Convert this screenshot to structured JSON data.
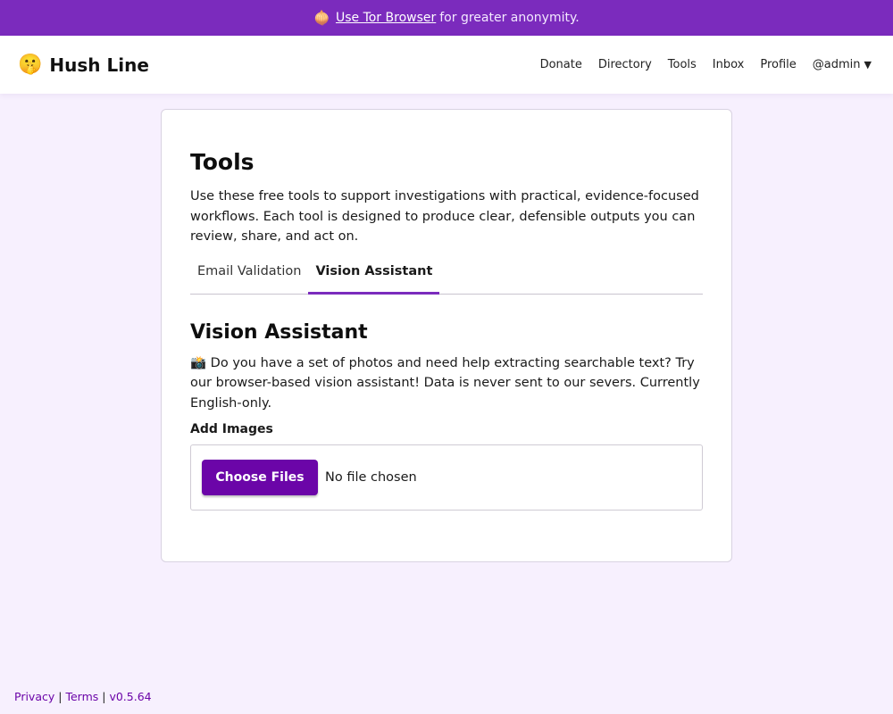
{
  "banner": {
    "icon": "onion-icon",
    "link_text": "Use Tor Browser",
    "suffix": "for greater anonymity."
  },
  "header": {
    "logo_emoji": "🤫",
    "brand": "Hush Line",
    "nav": {
      "donate": "Donate",
      "directory": "Directory",
      "tools": "Tools",
      "inbox": "Inbox",
      "profile": "Profile",
      "user": "@admin",
      "user_caret": "▼"
    }
  },
  "main": {
    "title": "Tools",
    "intro": "Use these free tools to support investigations with practical, evidence-focused workflows. Each tool is designed to produce clear, defensible outputs you can review, share, and act on.",
    "tabs": [
      {
        "label": "Email Validation",
        "active": false
      },
      {
        "label": "Vision Assistant",
        "active": true
      }
    ],
    "section": {
      "title": "Vision Assistant",
      "icon": "camera-flash-icon",
      "icon_glyph": "📸",
      "description": "Do you have a set of photos and need help extracting searchable text? Try our browser-based vision assistant! Data is never sent to our severs. Currently English-only.",
      "field_label": "Add Images",
      "button_label": "Choose Files",
      "file_status": "No file chosen"
    }
  },
  "footer": {
    "privacy": "Privacy",
    "separator": "|",
    "terms": "Terms",
    "version": "v0.5.64"
  },
  "colors": {
    "accent": "#7b2bbd",
    "button": "#6b05a8",
    "background": "#f7f0fe"
  }
}
